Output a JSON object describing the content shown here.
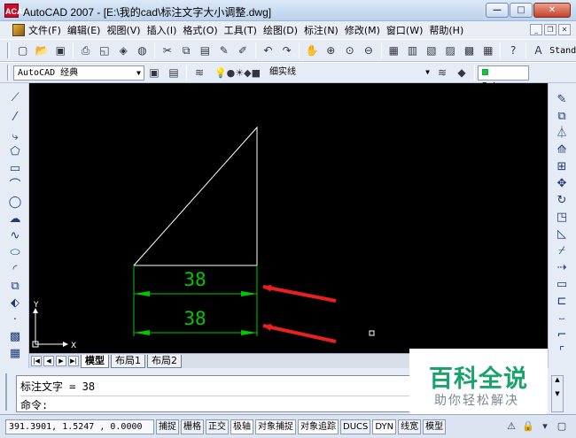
{
  "window": {
    "title": "AutoCAD 2007 - [E:\\我的cad\\标注文字大小调整.dwg]",
    "app_icon_text": "ACAD"
  },
  "menu": {
    "items": [
      "文件(F)",
      "编辑(E)",
      "视图(V)",
      "插入(I)",
      "格式(O)",
      "工具(T)",
      "绘图(D)",
      "标注(N)",
      "修改(M)",
      "窗口(W)",
      "帮助(H)"
    ]
  },
  "toolbar1": {
    "icons": [
      "new-icon",
      "open-icon",
      "save-icon",
      "print-icon",
      "preview-icon",
      "publish-icon",
      "plot-icon",
      "cut-icon",
      "copy-icon",
      "paste-icon",
      "match-icon",
      "brush-icon",
      "undo-icon",
      "redo-icon",
      "pan-icon",
      "zoom-realtime-icon",
      "zoom-window-icon",
      "zoom-previous-icon",
      "properties-icon",
      "design-center-icon",
      "tool-palettes-icon",
      "sheet-set-icon",
      "markup-icon",
      "calculator-icon",
      "help-icon"
    ],
    "text_style_label": "Stand"
  },
  "toolbar2": {
    "workspace": "AutoCAD 经典",
    "layer_name": "细实线",
    "color": "ByLayer"
  },
  "drawing": {
    "dimension_top": "38",
    "dimension_bottom": "38",
    "ucs_y": "Y",
    "ucs_x": "X",
    "line_color": "#ffffff",
    "dim_color": "#00c800",
    "arrow_color": "#e82020"
  },
  "tabs": {
    "items": [
      "模型",
      "布局1",
      "布局2"
    ],
    "active": "模型"
  },
  "command": {
    "history": "标注文字 = 38",
    "prompt": "命令:"
  },
  "watermark": {
    "main": "百科全说",
    "sub": "助你轻松解决"
  },
  "status": {
    "coordinates": "391.3901, 1.5247 , 0.0000",
    "toggles": [
      "捕捉",
      "栅格",
      "正交",
      "极轴",
      "对象捕捉",
      "对象追踪",
      "DUCS",
      "DYN",
      "线宽",
      "模型"
    ]
  }
}
